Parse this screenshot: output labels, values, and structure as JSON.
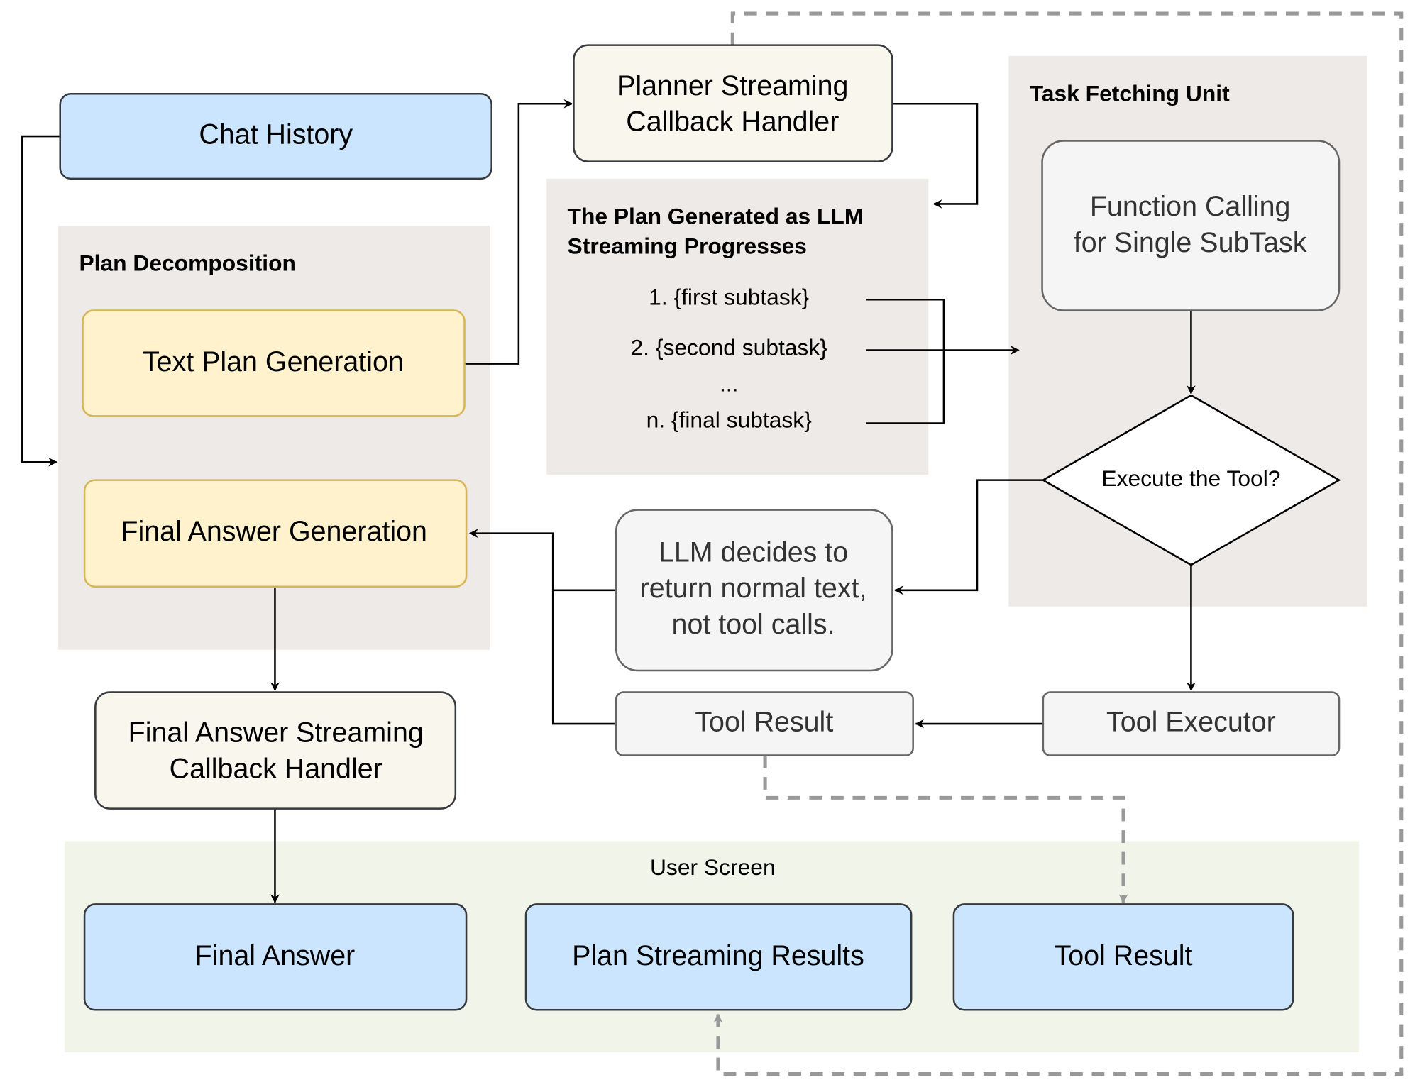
{
  "colors": {
    "blue_box": "#cce5ff",
    "yellow_box": "#fff2cc",
    "yellow_border": "#d6b656",
    "cream_box": "#f9f7ed",
    "gray_box": "#f5f5f5",
    "container": "#eeeae7",
    "user_screen": "#f1f5e9",
    "dashed_edge": "#999999"
  },
  "nodes": {
    "chat_history": "Chat History",
    "plan_decomposition": "Plan Decomposition",
    "text_plan_generation": "Text Plan Generation",
    "final_answer_generation": "Final Answer Generation",
    "planner_streaming": [
      "Planner Streaming",
      "Callback Handler"
    ],
    "plan_generated": {
      "title": [
        "The Plan Generated as LLM",
        "Streaming Progresses"
      ],
      "items": [
        "1. {first subtask}",
        "2. {second subtask}",
        "...",
        "n. {final subtask}"
      ]
    },
    "task_fetching_unit": "Task Fetching Unit",
    "function_calling": [
      "Function Calling",
      "for Single SubTask"
    ],
    "execute_tool": "Execute the Tool?",
    "llm_decides": [
      "LLM decides to",
      "return normal text,",
      "not tool calls."
    ],
    "tool_result_mid": "Tool Result",
    "tool_executor": "Tool Executor",
    "final_answer_streaming": [
      "Final Answer Streaming",
      "Callback Handler"
    ],
    "user_screen": "User Screen",
    "final_answer": "Final Answer",
    "plan_streaming_results": "Plan Streaming Results",
    "tool_result_bottom": "Tool Result"
  }
}
